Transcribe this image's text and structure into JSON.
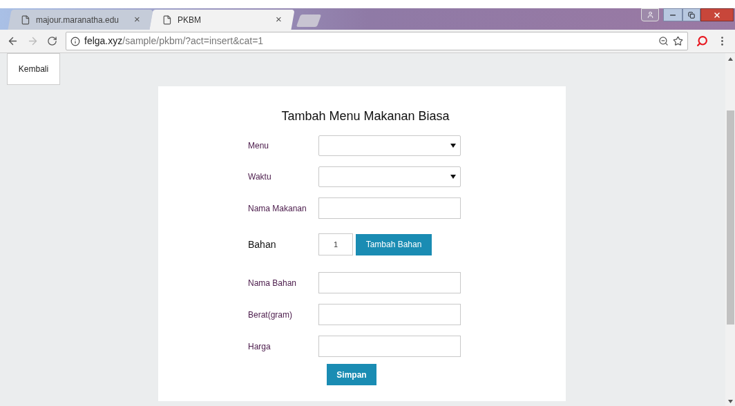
{
  "browser": {
    "tabs": [
      {
        "title": "majour.maranatha.edu",
        "close": "×",
        "selected": false
      },
      {
        "title": "PKBM",
        "close": "×",
        "selected": true
      }
    ],
    "url_host": "felga.xyz",
    "url_path": "/sample/pkbm/?act=insert&cat=1"
  },
  "back_button": "Kembali",
  "form": {
    "title": "Tambah Menu Makanan Biasa",
    "fields": [
      {
        "label": "Menu",
        "kind": "select"
      },
      {
        "label": "Waktu",
        "kind": "select"
      },
      {
        "label": "Nama Makanan",
        "kind": "text"
      }
    ],
    "bahan": {
      "label": "Bahan",
      "count": "1",
      "button": "Tambah Bahan"
    },
    "bahan_fields": [
      {
        "label": "Nama Bahan",
        "kind": "text"
      },
      {
        "label": "Berat(gram)",
        "kind": "text"
      },
      {
        "label": "Harga",
        "kind": "text"
      }
    ],
    "submit": "Simpan"
  }
}
